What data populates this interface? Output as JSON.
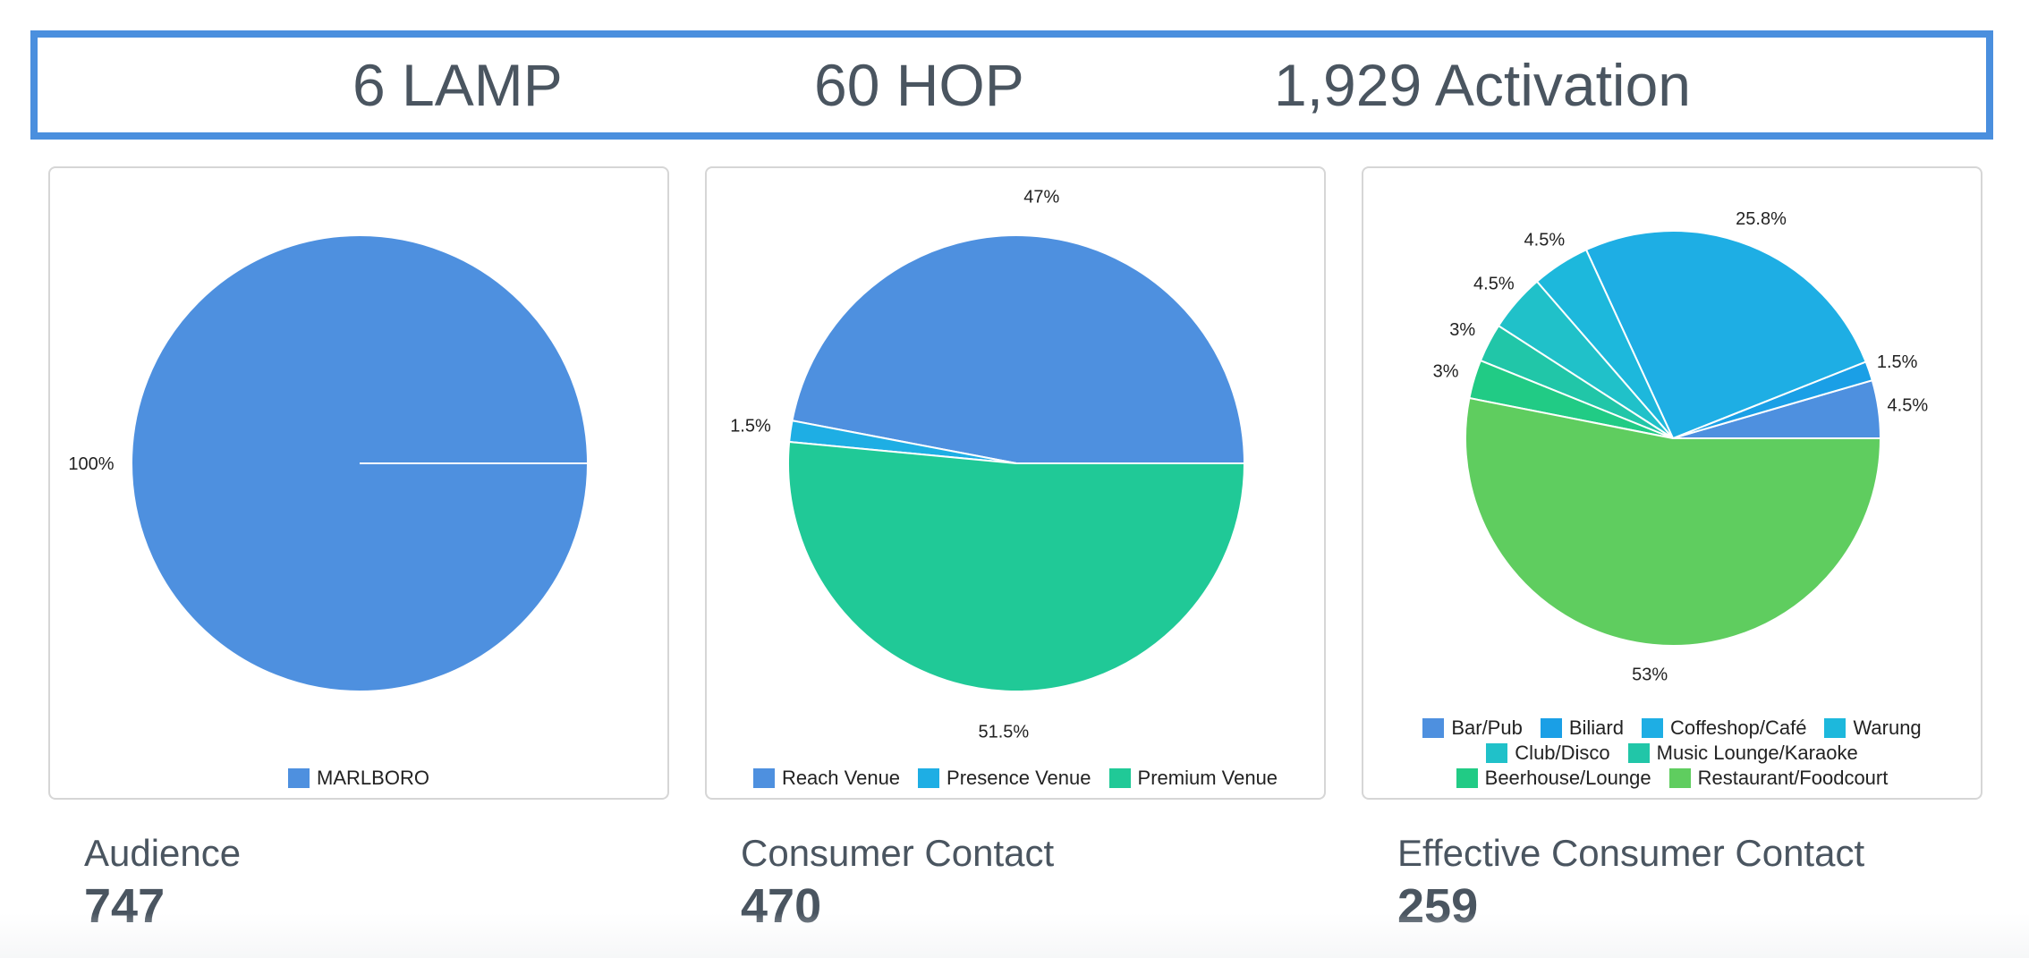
{
  "summary": {
    "lamp": "6 LAMP",
    "hop": "60 HOP",
    "activation": "1,929 Activation"
  },
  "colors": {
    "accent_border": "#4a8fde",
    "text": "#4a5560"
  },
  "chart_data": [
    {
      "type": "pie",
      "slices": [
        {
          "label": "MARLBORO",
          "value": 100,
          "display": "100%",
          "color": "#4e90df"
        }
      ],
      "legend": "bottom"
    },
    {
      "type": "pie",
      "slices": [
        {
          "label": "Reach Venue",
          "value": 47,
          "display": "47%",
          "color": "#4e90df"
        },
        {
          "label": "Presence Venue",
          "value": 1.5,
          "display": "1.5%",
          "color": "#1eaee4"
        },
        {
          "label": "Premium Venue",
          "value": 51.5,
          "display": "51.5%",
          "color": "#20c997"
        }
      ],
      "legend": "bottom"
    },
    {
      "type": "pie",
      "slices": [
        {
          "label": "Bar/Pub",
          "value": 4.5,
          "display": "4.5%",
          "color": "#4e90df"
        },
        {
          "label": "Biliard",
          "value": 1.5,
          "display": "1.5%",
          "color": "#1a9fe6"
        },
        {
          "label": "Coffeshop/Café",
          "value": 25.8,
          "display": "25.8%",
          "color": "#1eaee4"
        },
        {
          "label": "Warung",
          "value": 4.5,
          "display": "4.5%",
          "color": "#1db8dc"
        },
        {
          "label": "Club/Disco",
          "value": 4.5,
          "display": "4.5%",
          "color": "#20c1c9"
        },
        {
          "label": "Music Lounge/Karaoke",
          "value": 3,
          "display": "3%",
          "color": "#21c6a8"
        },
        {
          "label": "Beerhouse/Lounge",
          "value": 3,
          "display": "3%",
          "color": "#21cb85"
        },
        {
          "label": "Restaurant/Foodcourt",
          "value": 53,
          "display": "53%",
          "color": "#5fcd5f"
        }
      ],
      "legend": "bottom",
      "legend_rows": [
        [
          "Bar/Pub",
          "Biliard",
          "Coffeshop/Café",
          "Warung"
        ],
        [
          "Club/Disco",
          "Music Lounge/Karaoke"
        ],
        [
          "Beerhouse/Lounge",
          "Restaurant/Foodcourt"
        ]
      ]
    }
  ],
  "metrics": [
    {
      "title": "Audience",
      "value": "747"
    },
    {
      "title": "Consumer Contact",
      "value": "470"
    },
    {
      "title": "Effective Consumer Contact",
      "value": "259"
    }
  ]
}
